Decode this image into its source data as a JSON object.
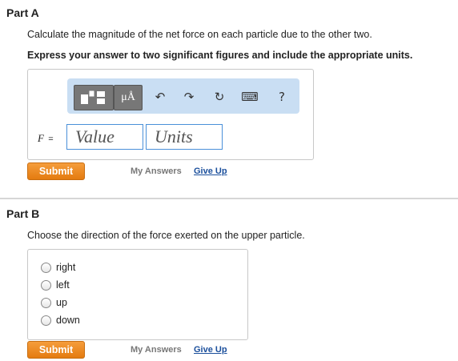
{
  "partA": {
    "title": "Part A",
    "instruction": "Calculate the magnitude of the net force on each particle due to the other two.",
    "instruction_bold": "Express your answer to two significant figures and include the appropriate units.",
    "toolbar": {
      "mu_label": "μÅ",
      "undo_icon": "↶",
      "redo_icon": "↷",
      "reset_icon": "↻",
      "keyboard_icon": "⌨",
      "help_label": "?"
    },
    "f_var": "F",
    "f_eq": "=",
    "value_placeholder": "Value",
    "units_placeholder": "Units",
    "submit_label": "Submit",
    "my_answers_label": "My Answers",
    "give_up_label": "Give Up"
  },
  "partB": {
    "title": "Part B",
    "instruction": "Choose the direction of the force exerted on the upper particle.",
    "options": [
      "right",
      "left",
      "up",
      "down"
    ],
    "submit_label": "Submit",
    "my_answers_label": "My Answers",
    "give_up_label": "Give Up"
  }
}
